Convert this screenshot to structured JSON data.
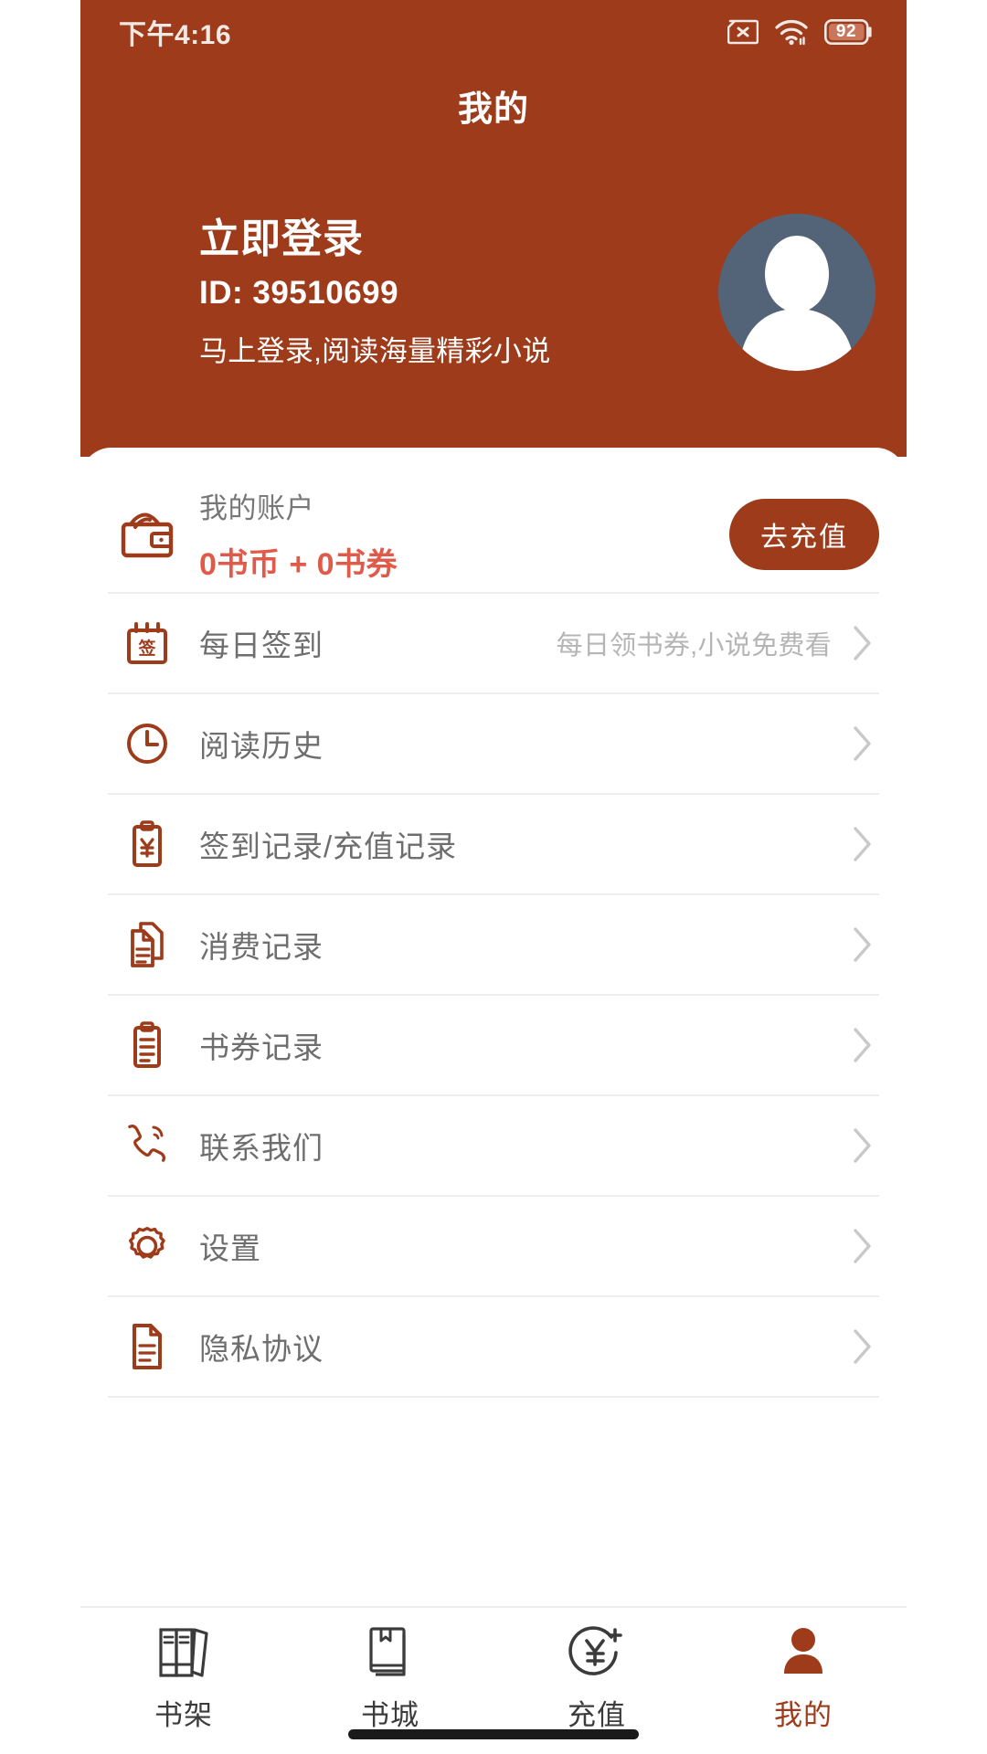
{
  "theme": {
    "brand": "#9d3b1a",
    "accent_red": "#e05a4a",
    "text_gray": "#6e6e6e",
    "hint_gray": "#b5b5b5",
    "avatar_bg": "#546478",
    "divider": "#eeeeee"
  },
  "status_bar": {
    "time": "下午4:16",
    "battery_level": "92",
    "sim_icon": "sim-card-off-icon",
    "wifi_icon": "wifi-icon",
    "battery_icon": "battery-icon"
  },
  "header": {
    "title": "我的"
  },
  "profile": {
    "login_title": "立即登录",
    "user_id": "ID: 39510699",
    "subtitle": "马上登录,阅读海量精彩小说",
    "avatar_icon": "default-avatar-icon"
  },
  "account": {
    "icon": "wallet-icon",
    "label": "我的账户",
    "balance": "0书币 + 0书券",
    "recharge_label": "去充值"
  },
  "menu": {
    "items": [
      {
        "icon": "calendar-checkin-icon",
        "label": "每日签到",
        "hint": "每日领书券,小说免费看"
      },
      {
        "icon": "clock-history-icon",
        "label": "阅读历史",
        "hint": ""
      },
      {
        "icon": "receipt-yen-icon",
        "label": "签到记录/充值记录",
        "hint": ""
      },
      {
        "icon": "documents-icon",
        "label": "消费记录",
        "hint": ""
      },
      {
        "icon": "clipboard-list-icon",
        "label": "书券记录",
        "hint": ""
      },
      {
        "icon": "phone-call-icon",
        "label": "联系我们",
        "hint": ""
      },
      {
        "icon": "gear-icon",
        "label": "设置",
        "hint": ""
      },
      {
        "icon": "document-text-icon",
        "label": "隐私协议",
        "hint": ""
      }
    ]
  },
  "tabbar": {
    "tabs": [
      {
        "icon": "bookshelf-icon",
        "label": "书架",
        "active": false
      },
      {
        "icon": "book-icon",
        "label": "书城",
        "active": false
      },
      {
        "icon": "yen-plus-icon",
        "label": "充值",
        "active": false
      },
      {
        "icon": "person-icon",
        "label": "我的",
        "active": true
      }
    ]
  }
}
